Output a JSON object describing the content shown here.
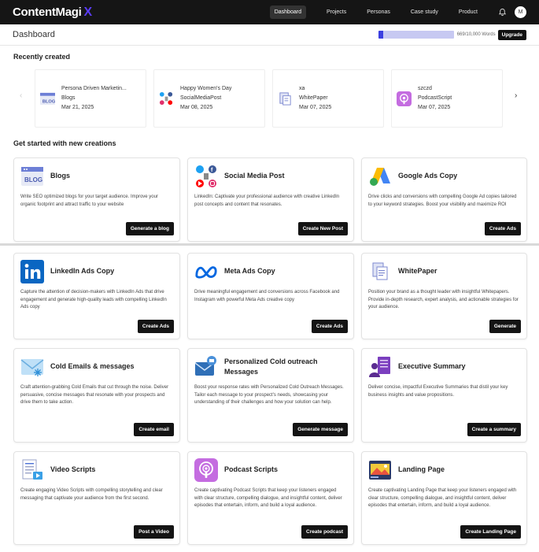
{
  "nav": {
    "logo": "ContentMagi",
    "logo_x": "X",
    "items": [
      "Dashboard",
      "Projects",
      "Personas",
      "Case study",
      "Product"
    ],
    "avatar": "M"
  },
  "header": {
    "title": "Dashboard",
    "usage_text": "669/10,000 Words",
    "usage_fraction": 0.067,
    "upgrade": "Upgrade"
  },
  "recent": {
    "title": "Recently created",
    "items": [
      {
        "name": "Persona Driven Marketin...",
        "type": "Blogs",
        "date": "Mar 21, 2025"
      },
      {
        "name": "Happy Women's Day",
        "type": "SocialMediaPost",
        "date": "Mar 08, 2025"
      },
      {
        "name": "xa",
        "type": "WhitePaper",
        "date": "Mar 07, 2025"
      },
      {
        "name": "szczd",
        "type": "PodcastScript",
        "date": "Mar 07, 2025"
      }
    ]
  },
  "creations": {
    "title": "Get started with new creations",
    "cards": [
      {
        "title": "Blogs",
        "desc": "Write SEO optimized blogs for your target audience. Improve your organic footprint and attract traffic to your website",
        "button": "Generate a blog"
      },
      {
        "title": "Social Media Post",
        "desc": "LinkedIn: Captivate your professional audience with creative LinkedIn post concepts and content that resonates.",
        "button": "Create New Post"
      },
      {
        "title": "Google Ads Copy",
        "desc": "Drive clicks and conversions with compelling Google Ad copies tailored to your keyword strategies. Boost your visibility and maximize ROI",
        "button": "Create Ads"
      },
      {
        "title": "LinkedIn Ads Copy",
        "desc": "Capture the attention of decision-makers with LinkedIn Ads that drive engagement and generate high-quality leads with compelling LinkedIn Ads copy",
        "button": "Create Ads"
      },
      {
        "title": "Meta Ads Copy",
        "desc": "Drive meaningful engagement and conversions across Facebook and Instagram with powerful Meta Ads creative copy",
        "button": "Create Ads"
      },
      {
        "title": "WhitePaper",
        "desc": "Position your brand as a thought leader with insightful Whitepapers. Provide in-depth research, expert analysis, and actionable strategies for your audience.",
        "button": "Generate"
      },
      {
        "title": "Cold Emails & messages",
        "desc": "Craft attention-grabbing Cold Emails that cut through the noise. Deliver persuasive, concise messages that resonate with your prospects and drive them to take action.",
        "button": "Create email"
      },
      {
        "title": "Personalized Cold outreach Messages",
        "desc": "Boost your response rates with Personalized Cold Outreach Messages. Tailor each message to your prospect's needs, showcasing your understanding of their challenges and how your solution can help.",
        "button": "Generate message"
      },
      {
        "title": "Executive Summary",
        "desc": "Deliver concise, impactful Executive Summaries that distil your key business insights and value propositions.",
        "button": "Create a summary"
      },
      {
        "title": "Video Scripts",
        "desc": "Create engaging Video Scripts with compelling storytelling and clear messaging that captivate your audience from the first second.",
        "button": "Post a Video"
      },
      {
        "title": "Podcast Scripts",
        "desc": "Create captivating Podcast Scripts that keep your listeners engaged with clear structure, compelling dialogue, and insightful content, deliver episodes that entertain, inform, and build a loyal audience.",
        "button": "Create podcast"
      },
      {
        "title": "Landing Page",
        "desc": "Create captivating Landing Page that keep your listeners engaged with clear structure, compelling dialogue, and insightful content, deliver episodes that entertain, inform, and build a loyal audience.",
        "button": "Create Landing Page"
      }
    ]
  },
  "icons": {
    "blog": "blog-icon",
    "social": "social-media-icon",
    "google": "google-ads-icon",
    "linkedin": "linkedin-icon",
    "meta": "meta-icon",
    "whitepaper": "whitepaper-icon",
    "email": "cold-email-icon",
    "outreach": "outreach-icon",
    "summary": "executive-summary-icon",
    "video": "video-script-icon",
    "podcast": "podcast-icon",
    "landing": "landing-page-icon"
  },
  "colors": {
    "accent": "#5a3cf5",
    "nav_bg": "#151515",
    "button": "#141414",
    "usage_fill": "#3b3fe0"
  }
}
